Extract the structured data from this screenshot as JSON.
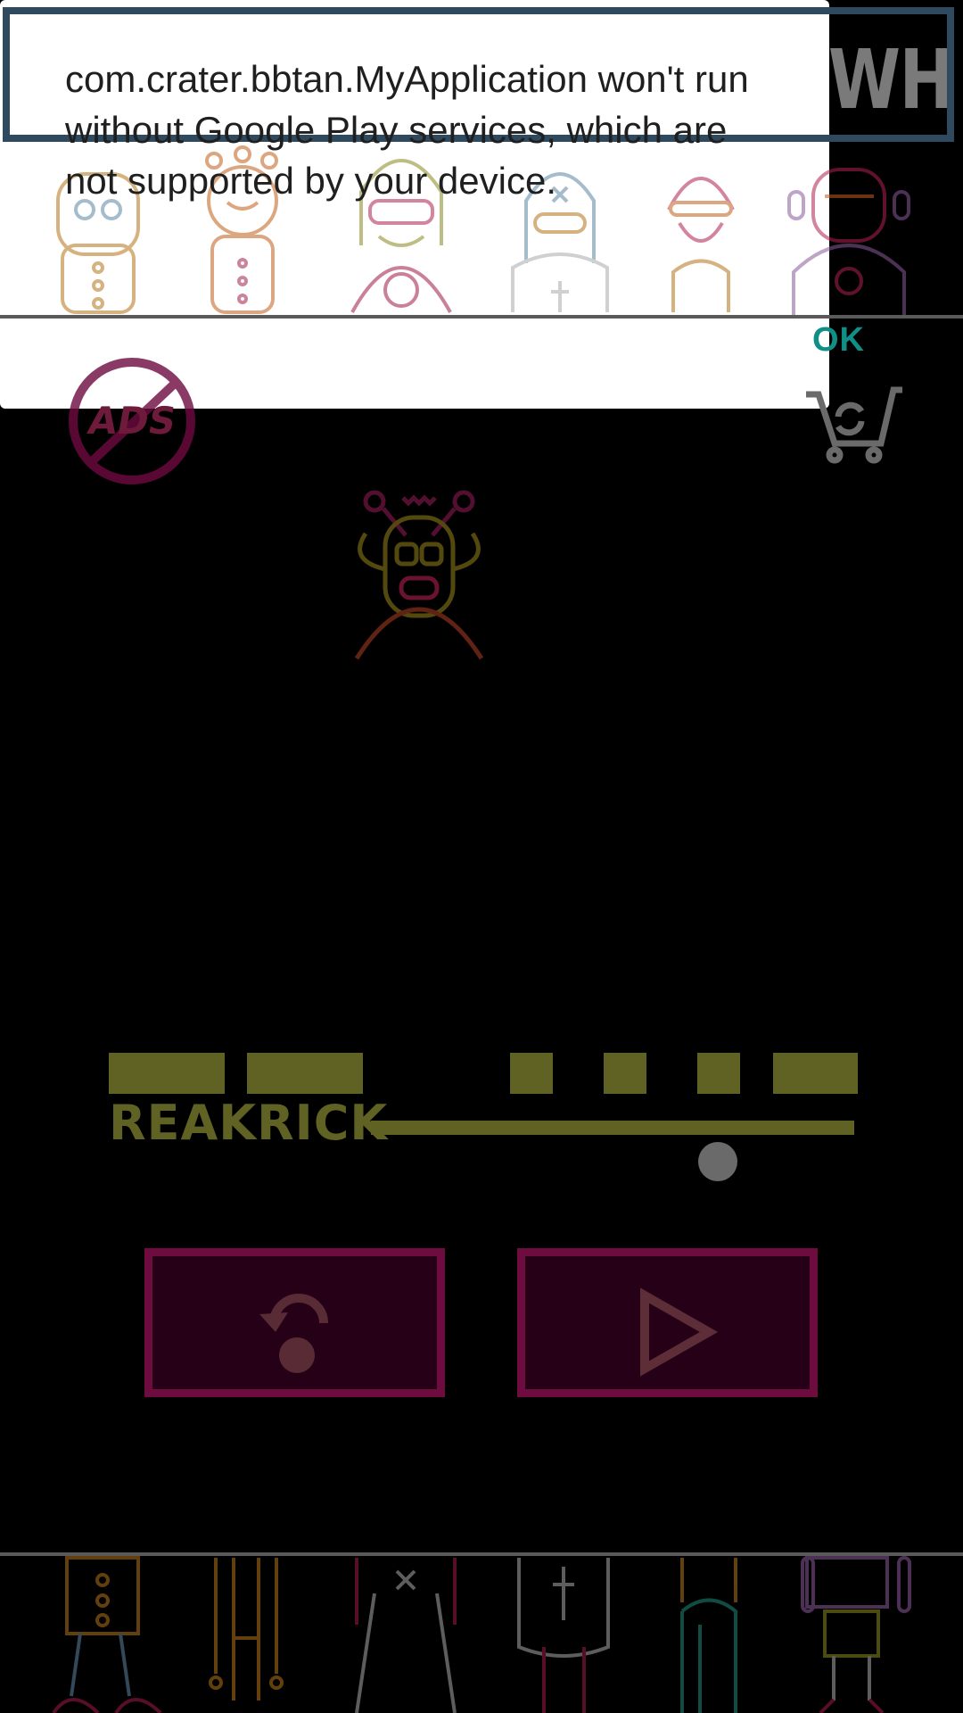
{
  "banner": {
    "marquee_text": "WH"
  },
  "dialog": {
    "message": "com.crater.bbtan.MyApplication won't run without Google Play services, which are not supported by your device.",
    "ok_label": "OK"
  },
  "game": {
    "logo_text": "REAKRICK",
    "remove_ads_icon_text": "ADS"
  },
  "icons": {
    "remove_ads": "no-ads-icon",
    "shop": "shopping-cart-icon",
    "restore": "restore-icon",
    "play": "play-icon"
  },
  "colors": {
    "dialog_accent": "#0f8f86",
    "button_border": "#6e0b3f",
    "logo": "#5f6223",
    "banner_border": "#2f4a5e"
  }
}
